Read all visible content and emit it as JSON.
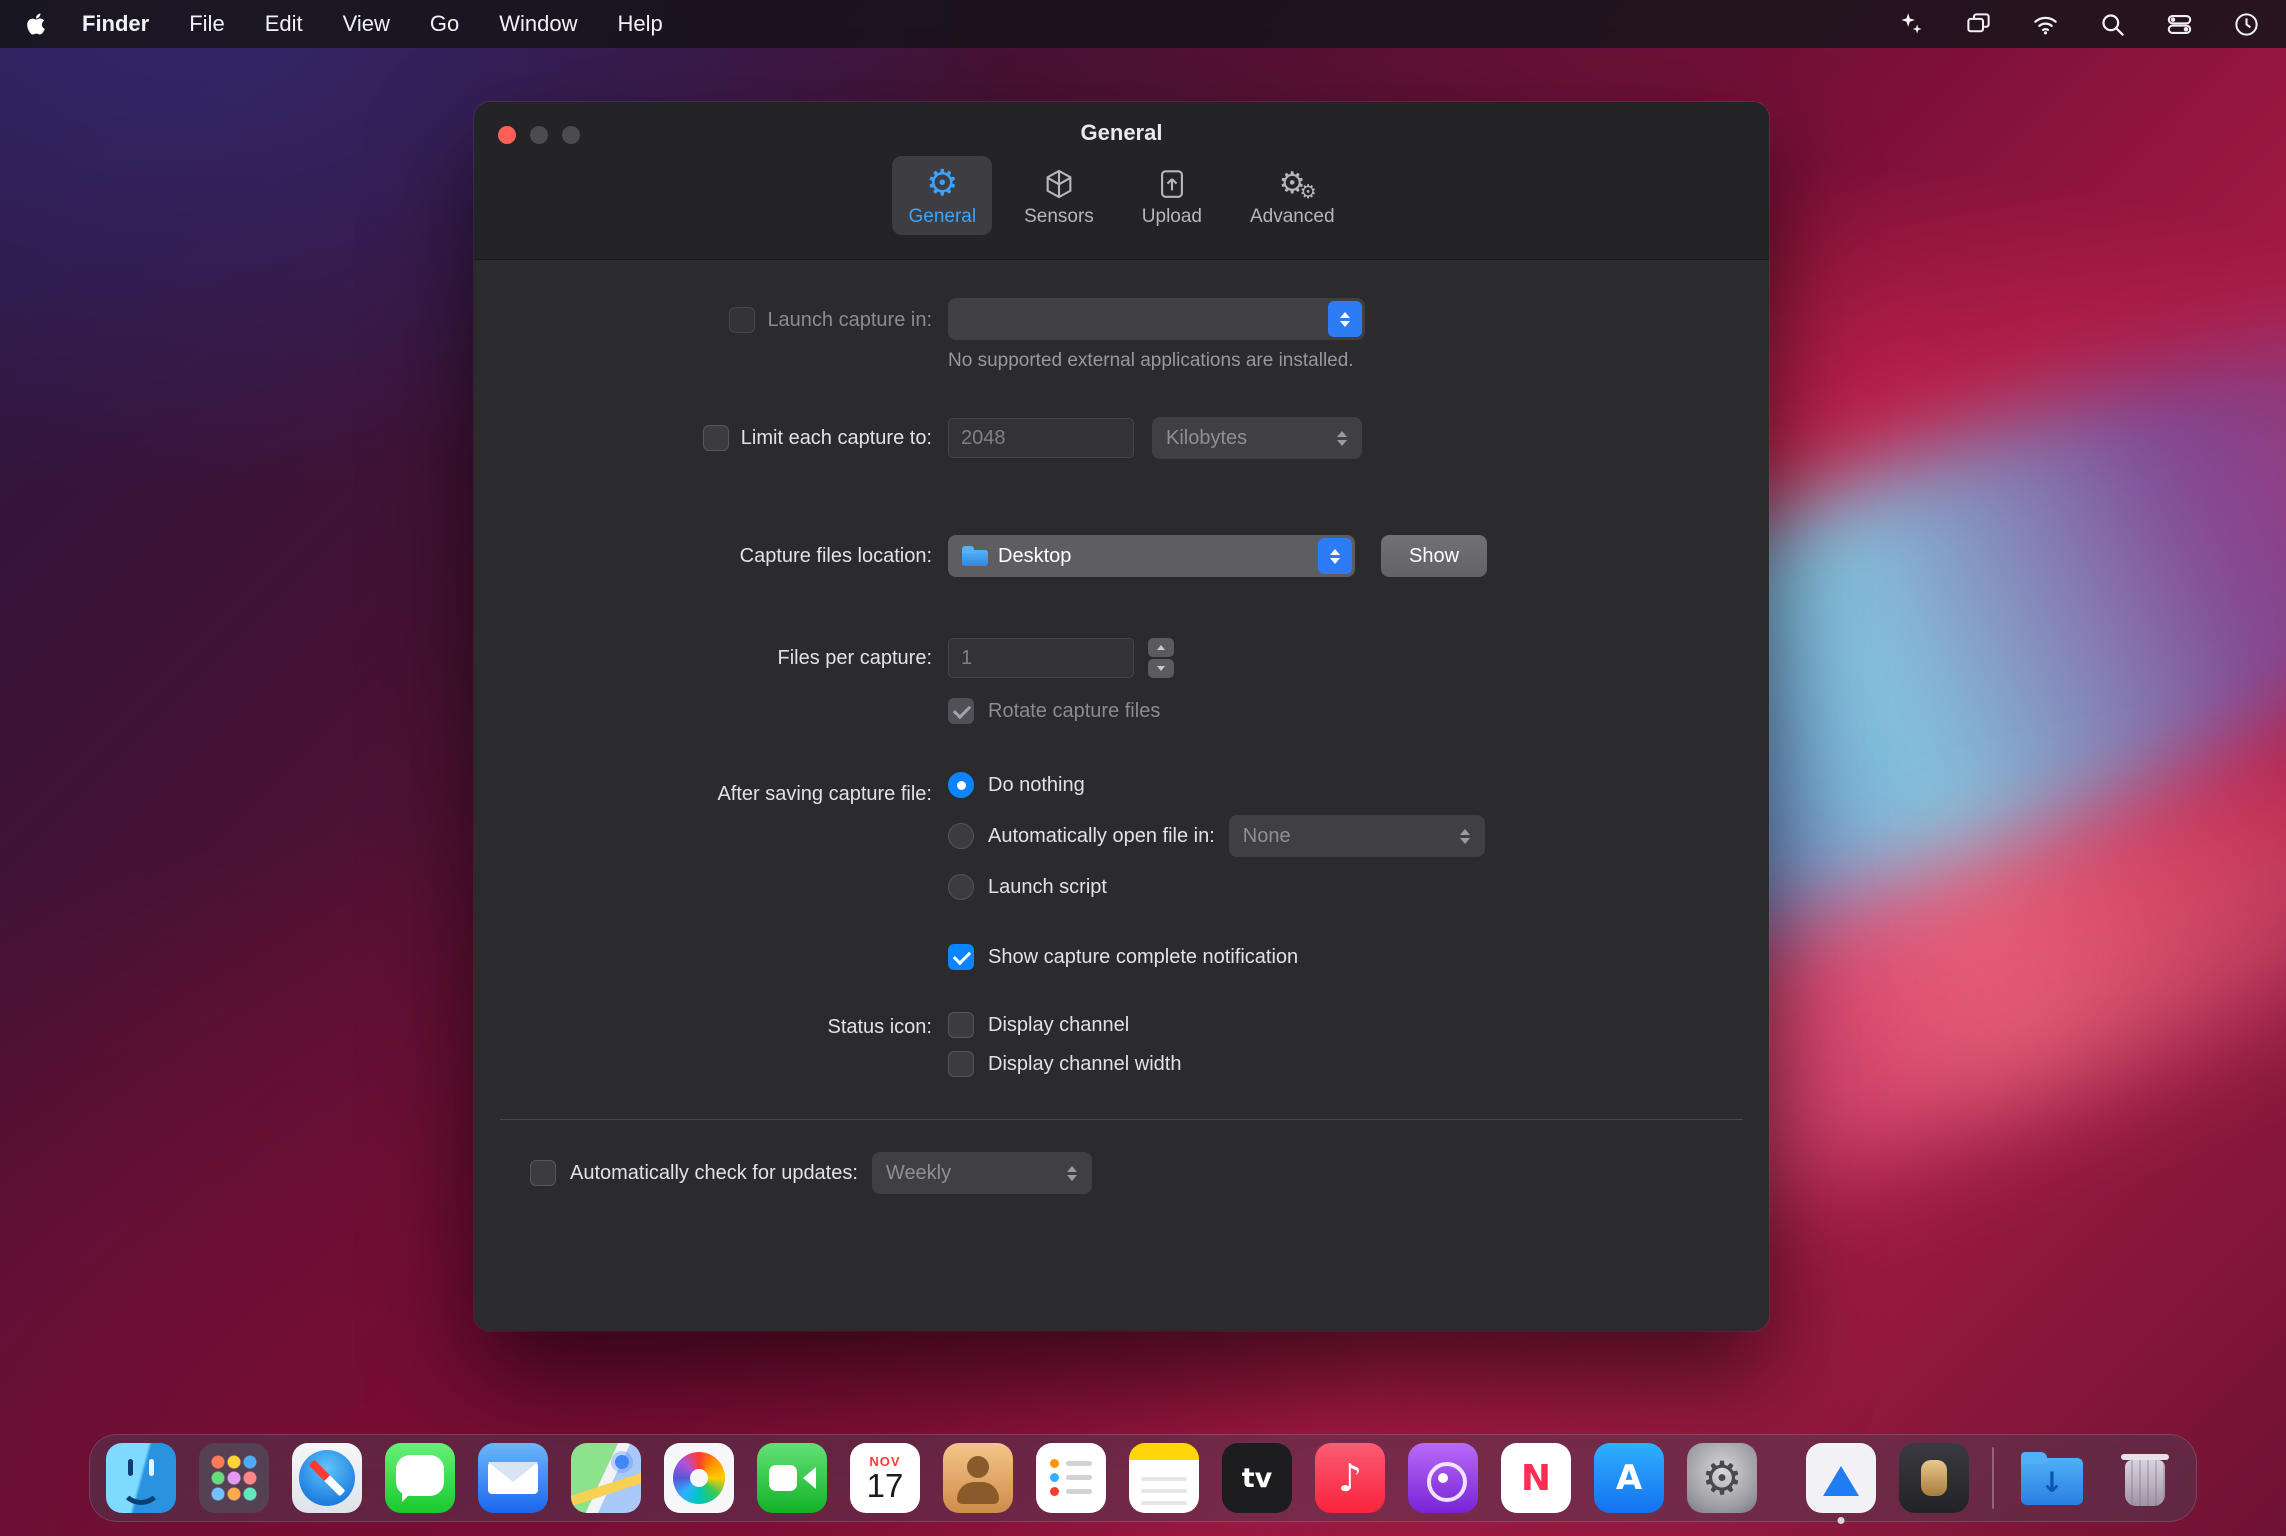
{
  "colors": {
    "accent": "#0a84ff",
    "tab_active": "#38a4ff",
    "traffic_red": "#ff5f57"
  },
  "menubar": {
    "app_name": "Finder",
    "menus": [
      "File",
      "Edit",
      "View",
      "Go",
      "Window",
      "Help"
    ],
    "status_icons": [
      "sparkles",
      "windows",
      "wifi",
      "search",
      "control-center",
      "clock"
    ]
  },
  "window": {
    "title": "General",
    "tabs": [
      {
        "label": "General",
        "icon": "gear",
        "active": true
      },
      {
        "label": "Sensors",
        "icon": "cube",
        "active": false
      },
      {
        "label": "Upload",
        "icon": "upload",
        "active": false
      },
      {
        "label": "Advanced",
        "icon": "gears",
        "active": false
      }
    ],
    "launch": {
      "label": "Launch capture in:",
      "value": "",
      "note": "No supported external applications are installed."
    },
    "limit": {
      "label": "Limit each capture to:",
      "size": "2048",
      "unit": "Kilobytes"
    },
    "location": {
      "label": "Capture files location:",
      "folder": "Desktop",
      "show_button": "Show"
    },
    "per_capture": {
      "label": "Files per capture:",
      "count": "1",
      "rotate": "Rotate capture files"
    },
    "after_saving": {
      "label": "After saving capture file:",
      "do_nothing": "Do nothing",
      "open_in": "Automatically open file in:",
      "open_in_value": "None",
      "launch_script": "Launch script"
    },
    "notification": "Show capture complete notification",
    "status_icon": {
      "label": "Status icon:",
      "channel": "Display channel",
      "channel_width": "Display channel width"
    },
    "updates": {
      "label": "Automatically check for updates:",
      "frequency": "Weekly"
    }
  },
  "dock": {
    "items": [
      {
        "name": "finder",
        "running": true
      },
      {
        "name": "launchpad"
      },
      {
        "name": "safari"
      },
      {
        "name": "messages"
      },
      {
        "name": "mail"
      },
      {
        "name": "maps"
      },
      {
        "name": "photos"
      },
      {
        "name": "facetime"
      },
      {
        "name": "calendar",
        "month": "NOV",
        "day": "17"
      },
      {
        "name": "contacts"
      },
      {
        "name": "reminders"
      },
      {
        "name": "notes"
      },
      {
        "name": "appletv",
        "glyph": "tv"
      },
      {
        "name": "music",
        "glyph": "♪"
      },
      {
        "name": "podcasts"
      },
      {
        "name": "news",
        "glyph": "N"
      },
      {
        "name": "appstore",
        "glyph": "A"
      },
      {
        "name": "sysprefs",
        "glyph": "⚙"
      },
      {
        "name": "appcapture",
        "running": true,
        "gap": true
      },
      {
        "name": "appaudio"
      },
      {
        "name": "downloads",
        "glyph": "↓",
        "divider_before": true
      },
      {
        "name": "trash"
      }
    ]
  }
}
